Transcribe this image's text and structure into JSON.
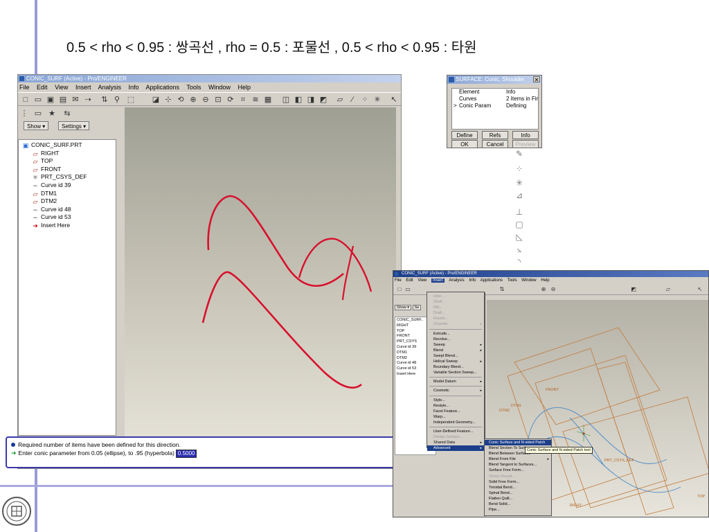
{
  "slide": {
    "title": "0.5 < rho < 0.95 : 쌍곡선 , rho = 0.5 : 포물선 , 0.5 < rho < 0.95 : 타원"
  },
  "main_window": {
    "title": "CONIC_SURF (Active) - Pro/ENGINEER",
    "menu": [
      "File",
      "Edit",
      "View",
      "Insert",
      "Analysis",
      "Info",
      "Applications",
      "Tools",
      "Window",
      "Help"
    ],
    "panel_buttons": {
      "show": "Show ▾",
      "settings": "Settings ▾"
    },
    "model_tree": [
      {
        "label": "CONIC_SURF.PRT",
        "icon": "part-icon"
      },
      {
        "label": "RIGHT",
        "icon": "datum-plane-icon"
      },
      {
        "label": "TOP",
        "icon": "datum-plane-icon"
      },
      {
        "label": "FRONT",
        "icon": "datum-plane-icon"
      },
      {
        "label": "PRT_CSYS_DEF",
        "icon": "csys-icon"
      },
      {
        "label": "Curve id 39",
        "icon": "curve-icon"
      },
      {
        "label": "DTM1",
        "icon": "datum-plane-icon"
      },
      {
        "label": "DTM2",
        "icon": "datum-plane-icon"
      },
      {
        "label": "Curve id 48",
        "icon": "curve-icon"
      },
      {
        "label": "Curve id 53",
        "icon": "curve-icon"
      },
      {
        "label": "Insert Here",
        "icon": "insert-arrow-icon"
      }
    ],
    "messages": {
      "line1": "Required number of items have been defined for this direction.",
      "line2": "Enter conic parameter from 0.05 (ellipse), to .95 (hyperbola)",
      "input_value": "0.5000"
    }
  },
  "surface_dialog": {
    "title": "SURFACE: Conic, Shoulder",
    "close": "✕",
    "headers": {
      "element": "Element",
      "info": "Info"
    },
    "rows": [
      {
        "marker": "",
        "element": "Curves",
        "info": "2 Items in Fir"
      },
      {
        "marker": ">",
        "element": "Conic Param",
        "info": "Defining"
      }
    ],
    "buttons": {
      "define": "Define",
      "refs": "Refs",
      "info": "Info",
      "ok": "OK",
      "cancel": "Cancel",
      "preview": "Preview"
    }
  },
  "inset_window": {
    "title": "CONIC_SURF (Active) - Pro/ENGINEER",
    "menu": [
      "File",
      "Edit",
      "View",
      "Insert",
      "Analysis",
      "Info",
      "Applications",
      "Tools",
      "Window",
      "Help"
    ],
    "active_menu": "Insert",
    "tree": [
      "CONIC_SURF..",
      "RIGHT",
      "TOP",
      "FRONT",
      "PRT_CSYS",
      "Curve id 39",
      "DTM1",
      "DTM2",
      "Curve id 48",
      "Curve id 53",
      "Insert Here"
    ],
    "panel_buttons": {
      "show": "Show ▾",
      "settings": "Se"
    },
    "insert_menu": [
      {
        "label": "Hole...",
        "state": "disabled"
      },
      {
        "label": "Shell...",
        "state": "disabled"
      },
      {
        "label": "Rib...",
        "state": "disabled"
      },
      {
        "label": "Draft...",
        "state": "disabled"
      },
      {
        "label": "Round...",
        "state": "disabled"
      },
      {
        "label": "Chamfer",
        "state": "disabled",
        "sub": true
      },
      {
        "sep": true
      },
      {
        "label": "Extrude...",
        "state": "normal"
      },
      {
        "label": "Revolve...",
        "state": "normal"
      },
      {
        "label": "Sweep",
        "state": "normal",
        "sub": true
      },
      {
        "label": "Blend",
        "state": "normal",
        "sub": true
      },
      {
        "label": "Swept Blend...",
        "state": "normal"
      },
      {
        "label": "Helical Sweep",
        "state": "normal",
        "sub": true
      },
      {
        "label": "Boundary Blend...",
        "state": "normal"
      },
      {
        "label": "Variable Section Sweep...",
        "state": "normal"
      },
      {
        "sep": true
      },
      {
        "label": "Model Datum",
        "state": "normal",
        "sub": true
      },
      {
        "sep": true
      },
      {
        "label": "Cosmetic",
        "state": "normal",
        "sub": true
      },
      {
        "sep": true
      },
      {
        "label": "Style...",
        "state": "normal"
      },
      {
        "label": "Restyle...",
        "state": "normal"
      },
      {
        "label": "Facet Feature...",
        "state": "normal"
      },
      {
        "label": "Warp...",
        "state": "normal"
      },
      {
        "label": "Independent Geometry...",
        "state": "normal"
      },
      {
        "sep": true
      },
      {
        "label": "User-Defined Feature...",
        "state": "normal"
      },
      {
        "label": "Design Surface...",
        "state": "disabled"
      },
      {
        "label": "Shared Data",
        "state": "normal",
        "sub": true
      },
      {
        "label": "Advanced",
        "state": "active",
        "sub": true
      }
    ],
    "advanced_menu": [
      {
        "label": "Conic Surface and N-sided Patch",
        "state": "active"
      },
      {
        "label": "Blend Section To Surfaces...",
        "state": "normal"
      },
      {
        "label": "Blend Between Surfaces",
        "state": "normal"
      },
      {
        "label": "Blend From File",
        "state": "normal",
        "sub": true
      },
      {
        "label": "Blend Tangent to Surfaces...",
        "state": "normal"
      },
      {
        "label": "Surface Free Form...",
        "state": "normal"
      },
      {
        "label": "Vertex Round...",
        "state": "disabled"
      },
      {
        "label": "Solid Free Form...",
        "state": "normal"
      },
      {
        "label": "Toroidal Bend...",
        "state": "normal"
      },
      {
        "label": "Spinal Bend...",
        "state": "normal"
      },
      {
        "label": "Flatten Quilt...",
        "state": "normal"
      },
      {
        "label": "Bend Solid...",
        "state": "normal"
      },
      {
        "label": "Pipe...",
        "state": "normal"
      }
    ],
    "tooltip": "Conic Surface and N-sided Patch tool",
    "datum_labels": [
      "FRONT",
      "DTM1",
      "DTM2",
      "PRT_CSYS_DEF",
      "RIGHT",
      "TOP"
    ]
  },
  "colors": {
    "accent": "#9a9ad8",
    "curve": "#d8102c",
    "message_border": "#3a3aa8",
    "menu_highlight": "#1d3f8a"
  }
}
